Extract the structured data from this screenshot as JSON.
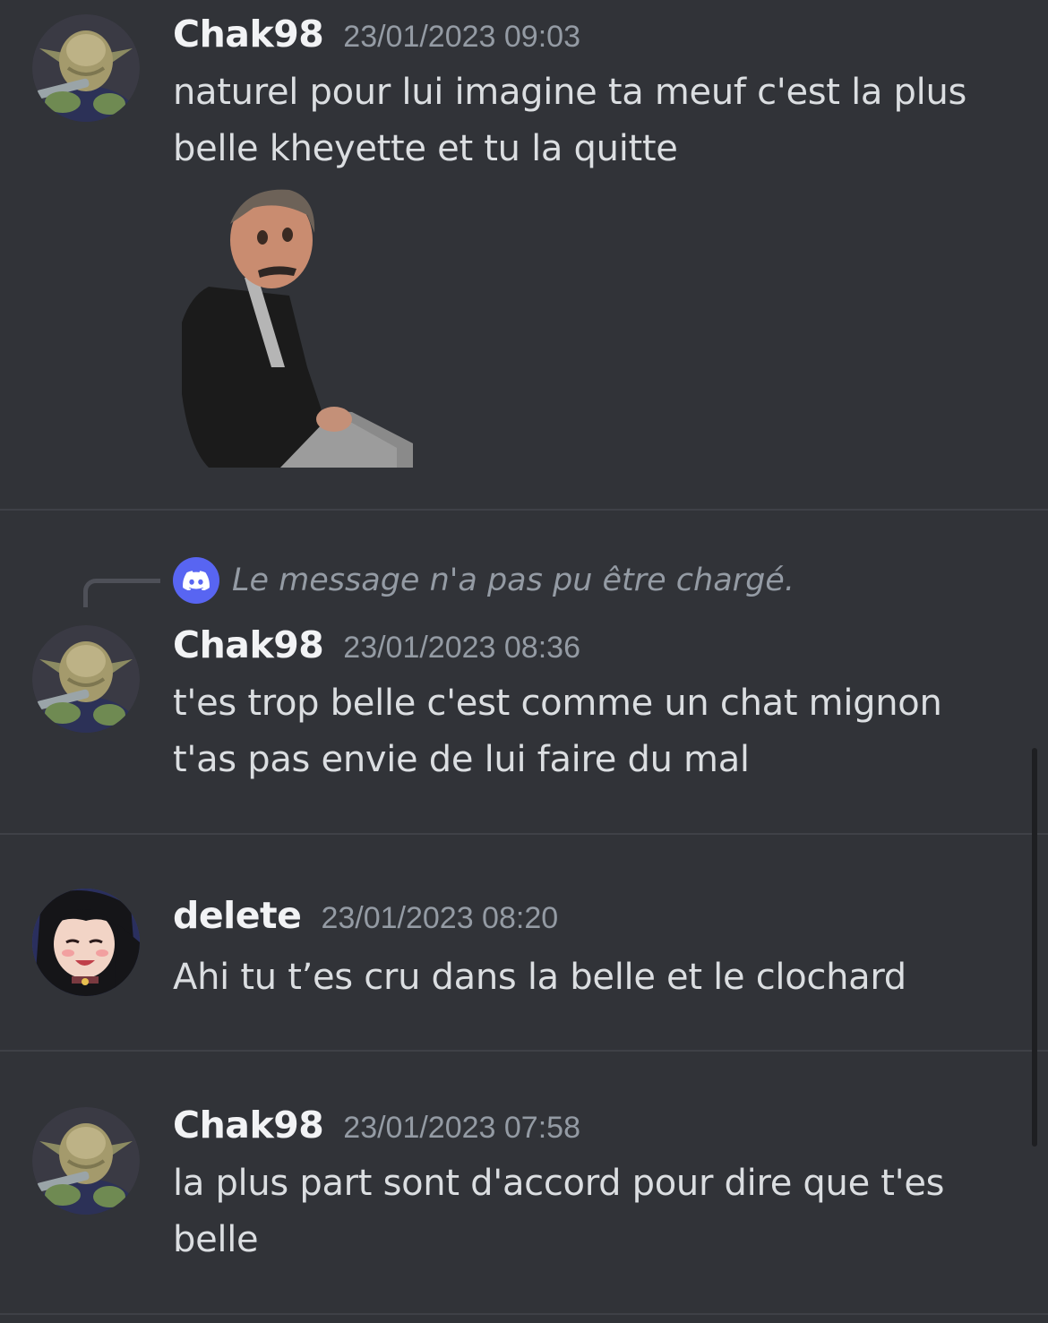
{
  "messages": [
    {
      "username": "Chak98",
      "timestamp": "23/01/2023 09:03",
      "content_lines": [
        "naturel pour lui  imagine ta meuf c'est la plus",
        "belle kheyette et tu la quitte"
      ],
      "avatar": "yoda-avatar",
      "attachment": "sticker-old-man-sitting"
    },
    {
      "reply_preview": "Le message n'a pas pu être chargé.",
      "reply_icon": "discord-logo-icon",
      "username": "Chak98",
      "timestamp": "23/01/2023 08:36",
      "content_lines": [
        "t'es trop belle c'est comme un chat mignon",
        "t'as pas envie de lui faire du mal"
      ],
      "avatar": "yoda-avatar"
    },
    {
      "username": "delete",
      "timestamp": "23/01/2023 08:20",
      "content_lines": [
        "Ahi tu t’es cru dans la belle et le clochard"
      ],
      "avatar": "anime-girl-avatar"
    },
    {
      "username": "Chak98",
      "timestamp": "23/01/2023 07:58",
      "content_lines": [
        "la plus part sont d'accord pour dire que t'es",
        "belle"
      ],
      "avatar": "yoda-avatar"
    }
  ],
  "colors": {
    "background": "#313338",
    "username": "#f2f3f5",
    "timestamp": "#949ba4",
    "text": "#dbdee1",
    "divider": "#3f4147",
    "blurple": "#5865f2"
  }
}
